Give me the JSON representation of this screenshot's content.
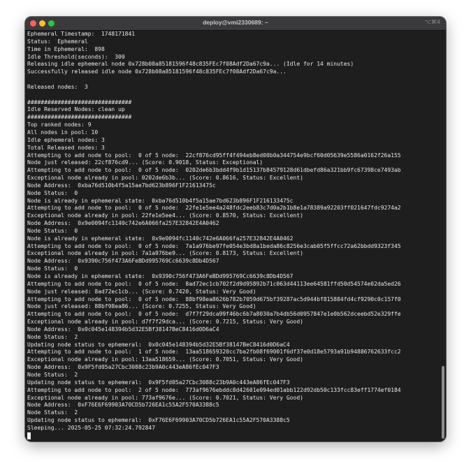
{
  "window": {
    "title": "deploy@vmi2330689: ~",
    "shortcut": "⌥⌘4"
  },
  "terminal": {
    "lines": [
      "Ephemeral Timestamp:  1748171841",
      "Status:  Ephemeral",
      "Time in Ephemeral:  898",
      "Idle Threshold(seconds):  300",
      "Releasing idle ephemeral node 0x728b08a85181596f48c835FEc7f08Adf2Da67c9a... (Idle for 14 minutes)",
      "Successfully released idle node 0x728b08a85181596f48c835FEc7f08Adf2Da67c9a...",
      "",
      "Released nodes:  3",
      "",
      "###############################",
      "Idle Reserved Nodes: clean up",
      "###############################",
      "Top ranked nodes: 9",
      "All nodes in pool: 10",
      "Idle ephemeral nodes: 3",
      "Total Released nodes: 3",
      "Attempting to add node to pool:  0 of 5 node:  22cf876cd95ff4f494eb8ed00b0a344754e9bcf60d05639e5586a0162f26a155",
      "Node just released: 22cf876cd9... (Score: 0.9018, Status: Exceptional)",
      "Attempting to add node to pool:  0 of 5 node:  0202de6b3bdd4f9b1d15137b84579128d61dbefd86a321bb9fc67398ce7493ab",
      "Exceptional node already in pool: 0202de6b3b... (Score: 0.8616, Status: Excellent)",
      "Node Address:  0xba76d510b4f5a15ae7bd623b896F1F21613475c",
      "Node Status:  0",
      "Node is already in ephemeral state:  0xba76d510b4f5a15ae7bd623b896F1F216133475c",
      "Attempting to add node to pool:  0 of 5 node:  22fe1e5ee4a248fdc2eeb83c7d0a2b1b8e1a78389a92203ff021647fdc9274a2",
      "Exceptional node already in pool: 22fe1e5ee4... (Score: 0.8570, Status: Excellent)",
      "Node Address:  0x9e0094fc1140c742e6A066fa257E32842E4A0462",
      "Node Status:  0",
      "Node is already in ephemeral state:  0x9e0094fc1140c742e6A066fa257E32842E4A0462",
      "Attempting to add node to pool:  0 of 5 node:  7a1a976be97fe054e3bd8a1beda86c8256e3cab05f5ffcc72a62bbdd9323f345",
      "Exceptional node already in pool: 7a1a976be9... (Score: 0.8173, Status: Excellent)",
      "Node Address:  0x9390c756f473A6FeBDd995769Cc6639c8Db4D567",
      "Node Status:  0",
      "Node is already in ephemeral state:  0x9390c756f473A6FeBDd995769Cc6639c8Db4D567",
      "Attempting to add node to pool:  0 of 5 node:  8ad72ec1cb702f2d9d95892b71c063d44113ee64581ffd50d54574e02da5ed26",
      "Node just released: 8ad72ec1cb... (Score: 0.7420, Status: Very Good)",
      "Attempting to add node to pool:  0 of 5 node:  88bf98ea8626b782b7059d675bf39287ac5d944bf815884fd4cf9290c0c157f0",
      "Node just released: 88bf98ea86... (Score: 0.7255, Status: Very Good)",
      "Attempting to add node to pool:  0 of 5 node:  d7f7f29dca99f46bc6b7a8030a7b4db56d0957847e1e0b562dceebd52e329ffe",
      "Exceptional node already in pool: d7f7f29dca... (Score: 0.7215, Status: Very Good)",
      "Node Address:  0x0c045e148394b5d32E5Bf38147BeC8416d0D6aC4",
      "Node Status:  2",
      "Updating node status to ephemeral:  0x0c045e148394b5d32E5Bf38147BeC8416d0D6aC4",
      "Attempting to add node to pool:  1 of 5 node:  13aa518659320cc7ba2fb08f69001f6df37e0d18e5793a91b94886762633fcc2",
      "Exceptional node already in pool: 13aa518659... (Score: 0.7051, Status: Very Good)",
      "Node Address:  0x9F5fd05a27Cbc3088c23b9A0c443eA86fEc047F3",
      "Node Status:  2",
      "Updating node status to ephemeral:  0x9F5fd05a27Cbc3088c23b9A0c443eA86fEc047F3",
      "Attempting to add node to pool:  2 of 5 node:  773af9676ebddc8d42601e094ed01abb122d92db50c133fcc83eff1774ef0184",
      "Exceptional node already in pool: 773af9676e... (Score: 0.7021, Status: Very Good)",
      "Node Address:  0xF76E6F69903A70CD5b726EA1c55A2F570A3388c5",
      "Node Status:  2",
      "Updating node status to ephemeral:  0xF76E6F69903A70CD5b726EA1c55A2F570A3388c5",
      "Sleeping... 2025-05-25 07:32:24.792847"
    ]
  }
}
